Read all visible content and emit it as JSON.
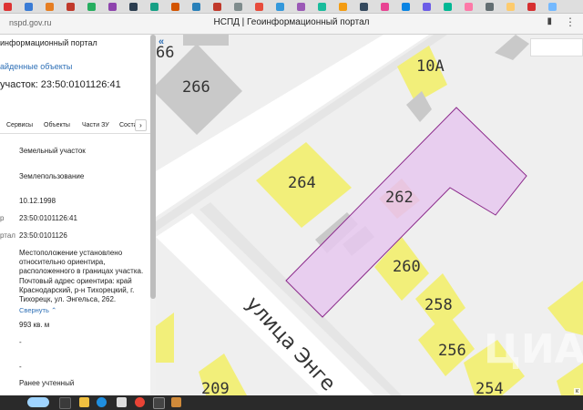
{
  "browser": {
    "url": "nspd.gov.ru",
    "page_title": "НСПД | Геоинформационный портал"
  },
  "panel": {
    "portal_title": "информационный портал",
    "found_link": "айденные объекты",
    "parcel_heading": "участок: 23:50:0101126:41",
    "tabs": [
      "Сервисы",
      "Объекты",
      "Части ЗУ",
      "Состав"
    ],
    "tab_more": "›",
    "fields": [
      {
        "label": "",
        "value": "Земельный участок"
      },
      {
        "label": "",
        "value": "Землепользование"
      },
      {
        "label": "",
        "value": "10.12.1998"
      },
      {
        "label": "р",
        "value": "23:50:0101126:41"
      },
      {
        "label": "ртал",
        "value": "23:50:0101126"
      }
    ],
    "location_text": "Местоположение установлено относительно ориентира, расположенного в границах участка. Почтовый адрес ориентира: край Краснодарский, р-н Тихорецкий, г. Тихорецк, ул. Энгельса, 262.",
    "collapse_link": "Свернуть",
    "area": "993 кв. м",
    "dash1": "-",
    "dash2": "-",
    "status": "Ранее учтенный"
  },
  "map": {
    "labels": [
      "266",
      "10А",
      "264",
      "262",
      "260",
      "258",
      "256",
      "254",
      "209",
      "66"
    ],
    "street": "улица Энге",
    "coords_text": "к",
    "watermark": "ЦИАН"
  },
  "colors": {
    "parcel_fill": "#e6c8ee",
    "parcel_stroke": "#8b2a8b",
    "building_yellow": "#f2ef7a",
    "building_gray": "#c9c9c9",
    "link_blue": "#2d6fb6"
  }
}
